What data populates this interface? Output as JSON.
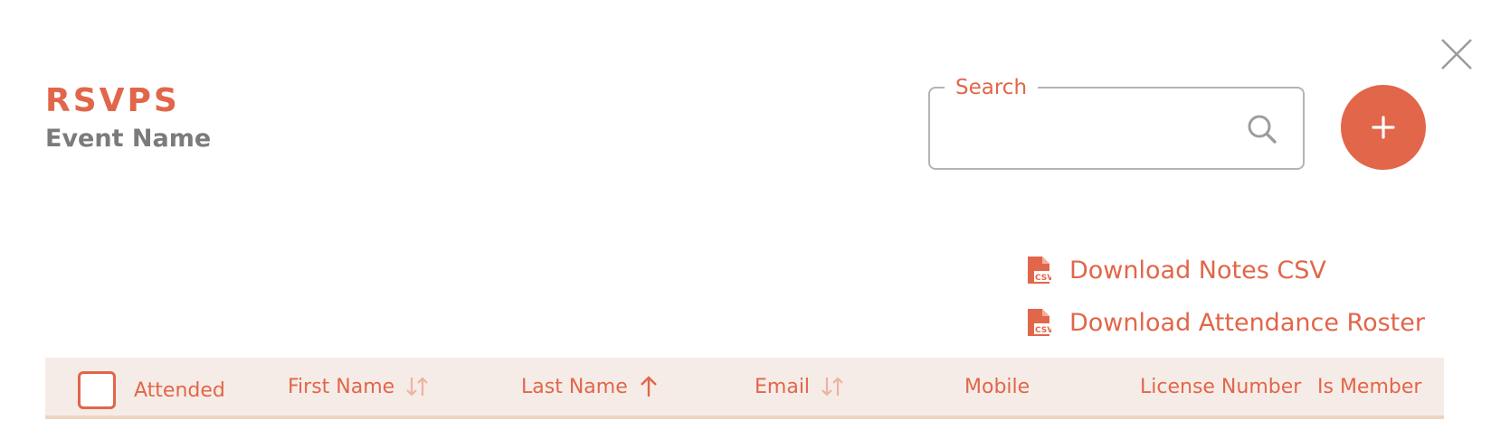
{
  "header": {
    "title": "RSVPS",
    "event_name": "Event Name"
  },
  "search": {
    "label": "Search",
    "value": "",
    "placeholder": ""
  },
  "actions": {
    "add_label": "+",
    "download_notes": "Download Notes CSV",
    "download_roster": "Download Attendance Roster"
  },
  "table": {
    "columns": [
      {
        "label": "Attended",
        "sort": "none-shown"
      },
      {
        "label": "First Name",
        "sort": "unsorted"
      },
      {
        "label": "Last Name",
        "sort": "ascending"
      },
      {
        "label": "Email",
        "sort": "unsorted"
      },
      {
        "label": "Mobile",
        "sort": "none-shown"
      },
      {
        "label": "License Number",
        "sort": "none-shown"
      },
      {
        "label": "Is Member",
        "sort": "none-shown"
      }
    ]
  },
  "icons": {
    "close": "close-icon",
    "search": "search-icon",
    "add": "plus-icon",
    "csv": "csv-file-icon",
    "sort_unsorted": "sort-both-icon",
    "sort_ascending": "arrow-up-icon"
  },
  "colors": {
    "accent": "#e1664a",
    "muted_text": "#7b7b7b",
    "header_bg": "#f6ece7",
    "header_border": "#ebd6c4"
  }
}
